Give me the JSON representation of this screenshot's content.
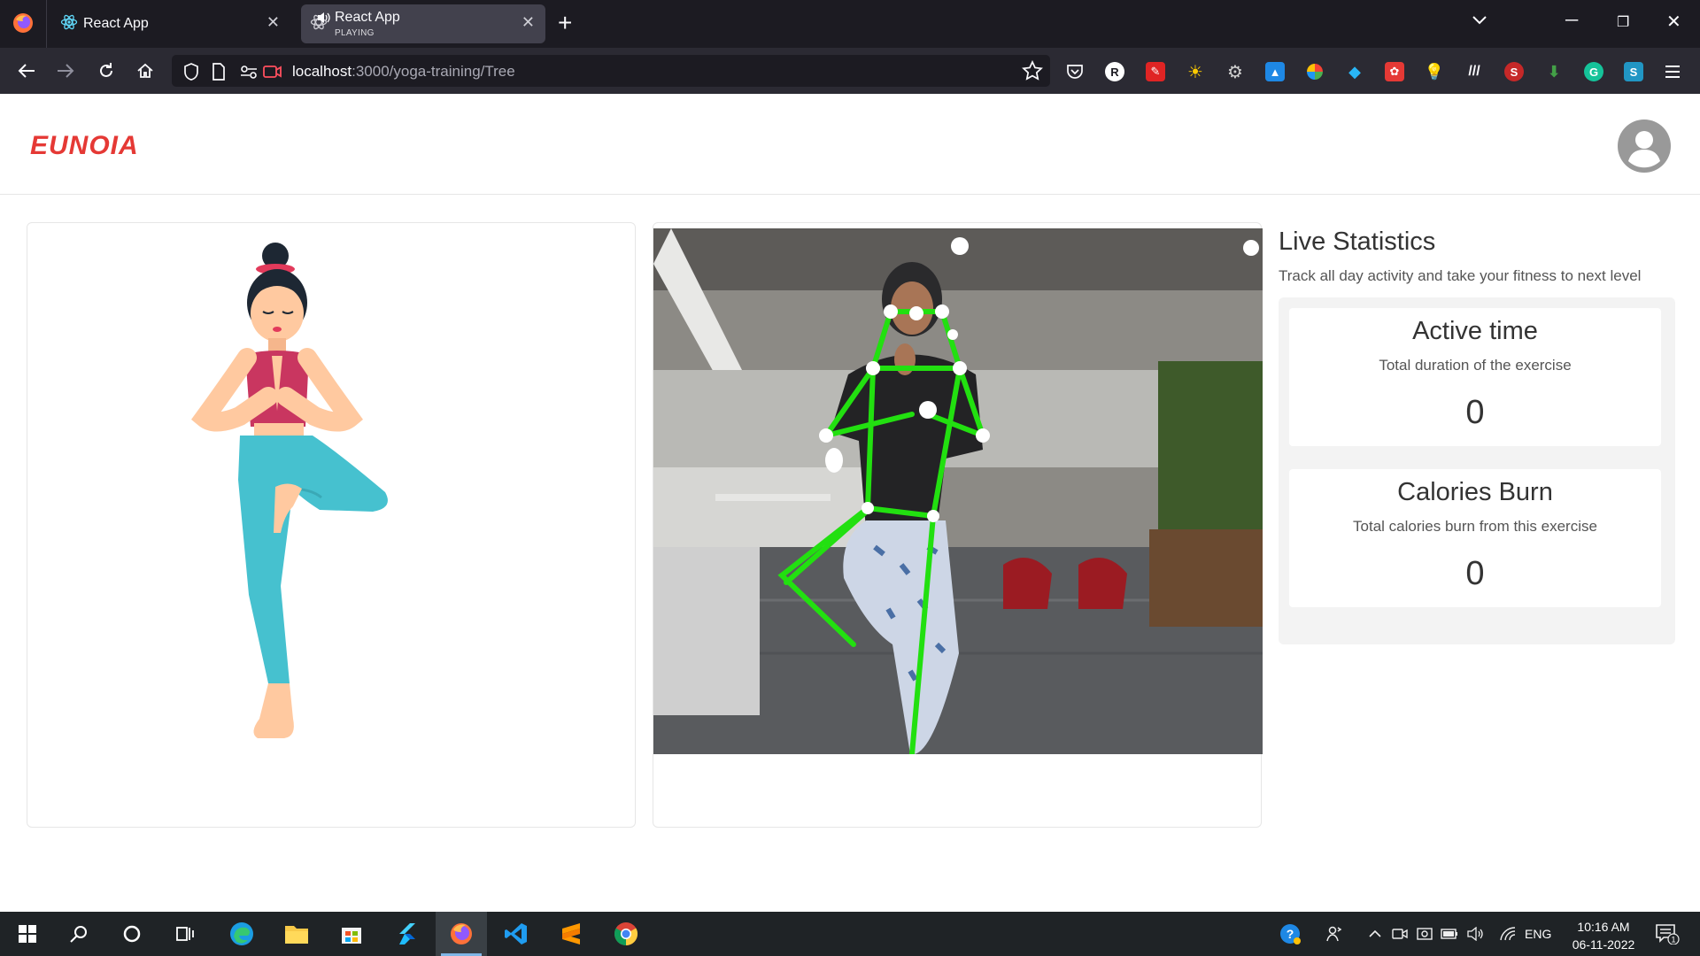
{
  "browser": {
    "tabs": [
      {
        "title": "React App"
      },
      {
        "title": "React App",
        "status": "PLAYING"
      }
    ],
    "url": {
      "host": "localhost",
      "rest": ":3000/yoga-training/Tree"
    }
  },
  "app": {
    "brand": "EUNOIA",
    "brand_color": "#e53935"
  },
  "pose_panel": {
    "pose_name": "Tree",
    "icon": "yoga-tree-pose-illustration"
  },
  "camera_panel": {
    "icon": "webcam-feed-with-skeleton",
    "skeleton_color": "#22e010"
  },
  "stats": {
    "title": "Live Statistics",
    "subtitle": "Track all day activity and take your fitness to next level",
    "cards": [
      {
        "title": "Active time",
        "description": "Total duration of the exercise",
        "value": "0"
      },
      {
        "title": "Calories Burn",
        "description": "Total calories burn from this exercise",
        "value": "0"
      }
    ]
  },
  "taskbar": {
    "language": "ENG",
    "time": "10:16 AM",
    "date": "06-11-2022",
    "notification_count": "1"
  }
}
